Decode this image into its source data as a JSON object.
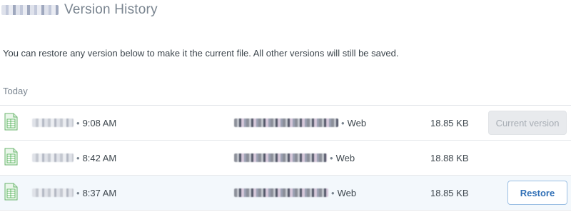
{
  "header": {
    "title": "Version History"
  },
  "description": "You can restore any version below to make it the current file. All other versions will still be saved.",
  "section": {
    "label": "Today"
  },
  "icons": {
    "file": "spreadsheet-file-icon"
  },
  "colors": {
    "accent": "#2f6fb6",
    "file_icon_green": "#4caf50",
    "row_highlight": "#f3f8fc"
  },
  "versions": [
    {
      "time": "9:08 AM",
      "source": "Web",
      "size": "18.85 KB",
      "action": "Current version"
    },
    {
      "time": "8:42 AM",
      "source": "Web",
      "size": "18.88 KB",
      "action": ""
    },
    {
      "time": "8:37 AM",
      "source": "Web",
      "size": "18.85 KB",
      "action": "Restore"
    }
  ]
}
